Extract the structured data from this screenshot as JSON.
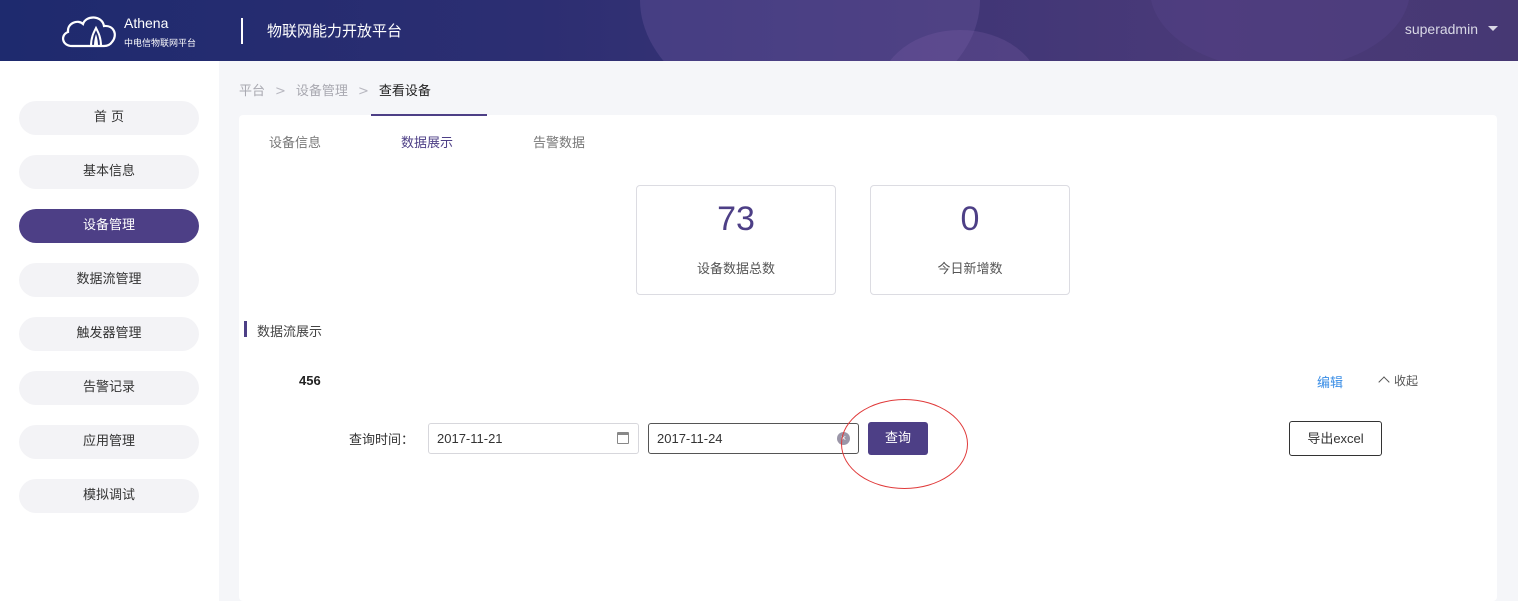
{
  "header": {
    "brand_name": "Athena",
    "brand_sub": "中电信物联网平台",
    "platform_title": "物联网能力开放平台",
    "username": "superadmin"
  },
  "sidebar": {
    "items": [
      {
        "label": "首 页",
        "active": false
      },
      {
        "label": "基本信息",
        "active": false
      },
      {
        "label": "设备管理",
        "active": true
      },
      {
        "label": "数据流管理",
        "active": false
      },
      {
        "label": "触发器管理",
        "active": false
      },
      {
        "label": "告警记录",
        "active": false
      },
      {
        "label": "应用管理",
        "active": false
      },
      {
        "label": "模拟调试",
        "active": false
      }
    ]
  },
  "breadcrumb": {
    "items": [
      "平台",
      "设备管理",
      "查看设备"
    ],
    "separator": ">"
  },
  "tabs": [
    {
      "label": "设备信息",
      "active": false
    },
    {
      "label": "数据展示",
      "active": true
    },
    {
      "label": "告警数据",
      "active": false
    }
  ],
  "stats": [
    {
      "value": "73",
      "label": "设备数据总数"
    },
    {
      "value": "0",
      "label": "今日新增数"
    }
  ],
  "section": {
    "title": "数据流展示"
  },
  "datastream": {
    "name": "456",
    "edit_label": "编辑",
    "collapse_label": "收起",
    "query_label": "查询时间：",
    "start_date": "2017-11-21",
    "end_date": "2017-11-24",
    "query_button": "查询",
    "export_button": "导出excel"
  },
  "colors": {
    "accent": "#4d3f86",
    "link": "#3a8ee6",
    "annotation": "#e03a3a"
  }
}
